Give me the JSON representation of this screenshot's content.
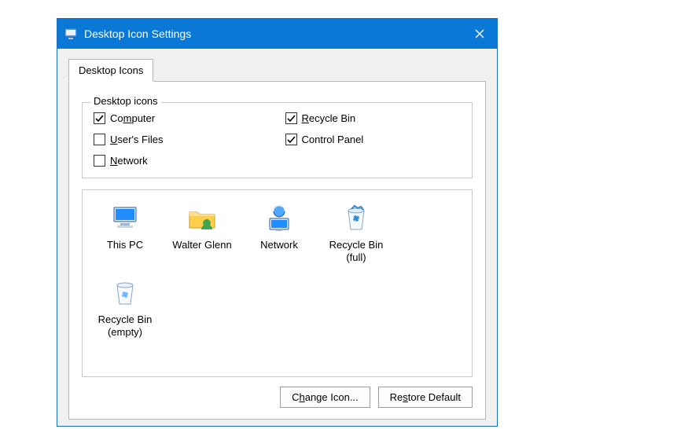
{
  "window": {
    "title": "Desktop Icon Settings"
  },
  "tab": {
    "label": "Desktop Icons"
  },
  "group": {
    "legend": "Desktop icons",
    "items": [
      {
        "label": "Computer",
        "underline_index": 2,
        "checked": true
      },
      {
        "label": "Recycle Bin",
        "underline_index": 0,
        "checked": true
      },
      {
        "label": "User's Files",
        "underline_index": 0,
        "checked": false
      },
      {
        "label": "Control Panel",
        "underline_index": -1,
        "checked": true
      },
      {
        "label": "Network",
        "underline_index": 0,
        "checked": false
      }
    ]
  },
  "icons": [
    {
      "name": "this-pc",
      "label": "This PC",
      "kind": "computer"
    },
    {
      "name": "user-files",
      "label": "Walter Glenn",
      "kind": "userfolder"
    },
    {
      "name": "network",
      "label": "Network",
      "kind": "network"
    },
    {
      "name": "recycle-bin-full",
      "label": "Recycle Bin\n(full)",
      "kind": "bin-full"
    },
    {
      "name": "recycle-bin-empty",
      "label": "Recycle Bin\n(empty)",
      "kind": "bin-empty"
    }
  ],
  "buttons": {
    "change_icon": {
      "label": "Change Icon...",
      "underline_index": 1
    },
    "restore_default": {
      "label": "Restore Default",
      "underline_index": 2
    }
  }
}
